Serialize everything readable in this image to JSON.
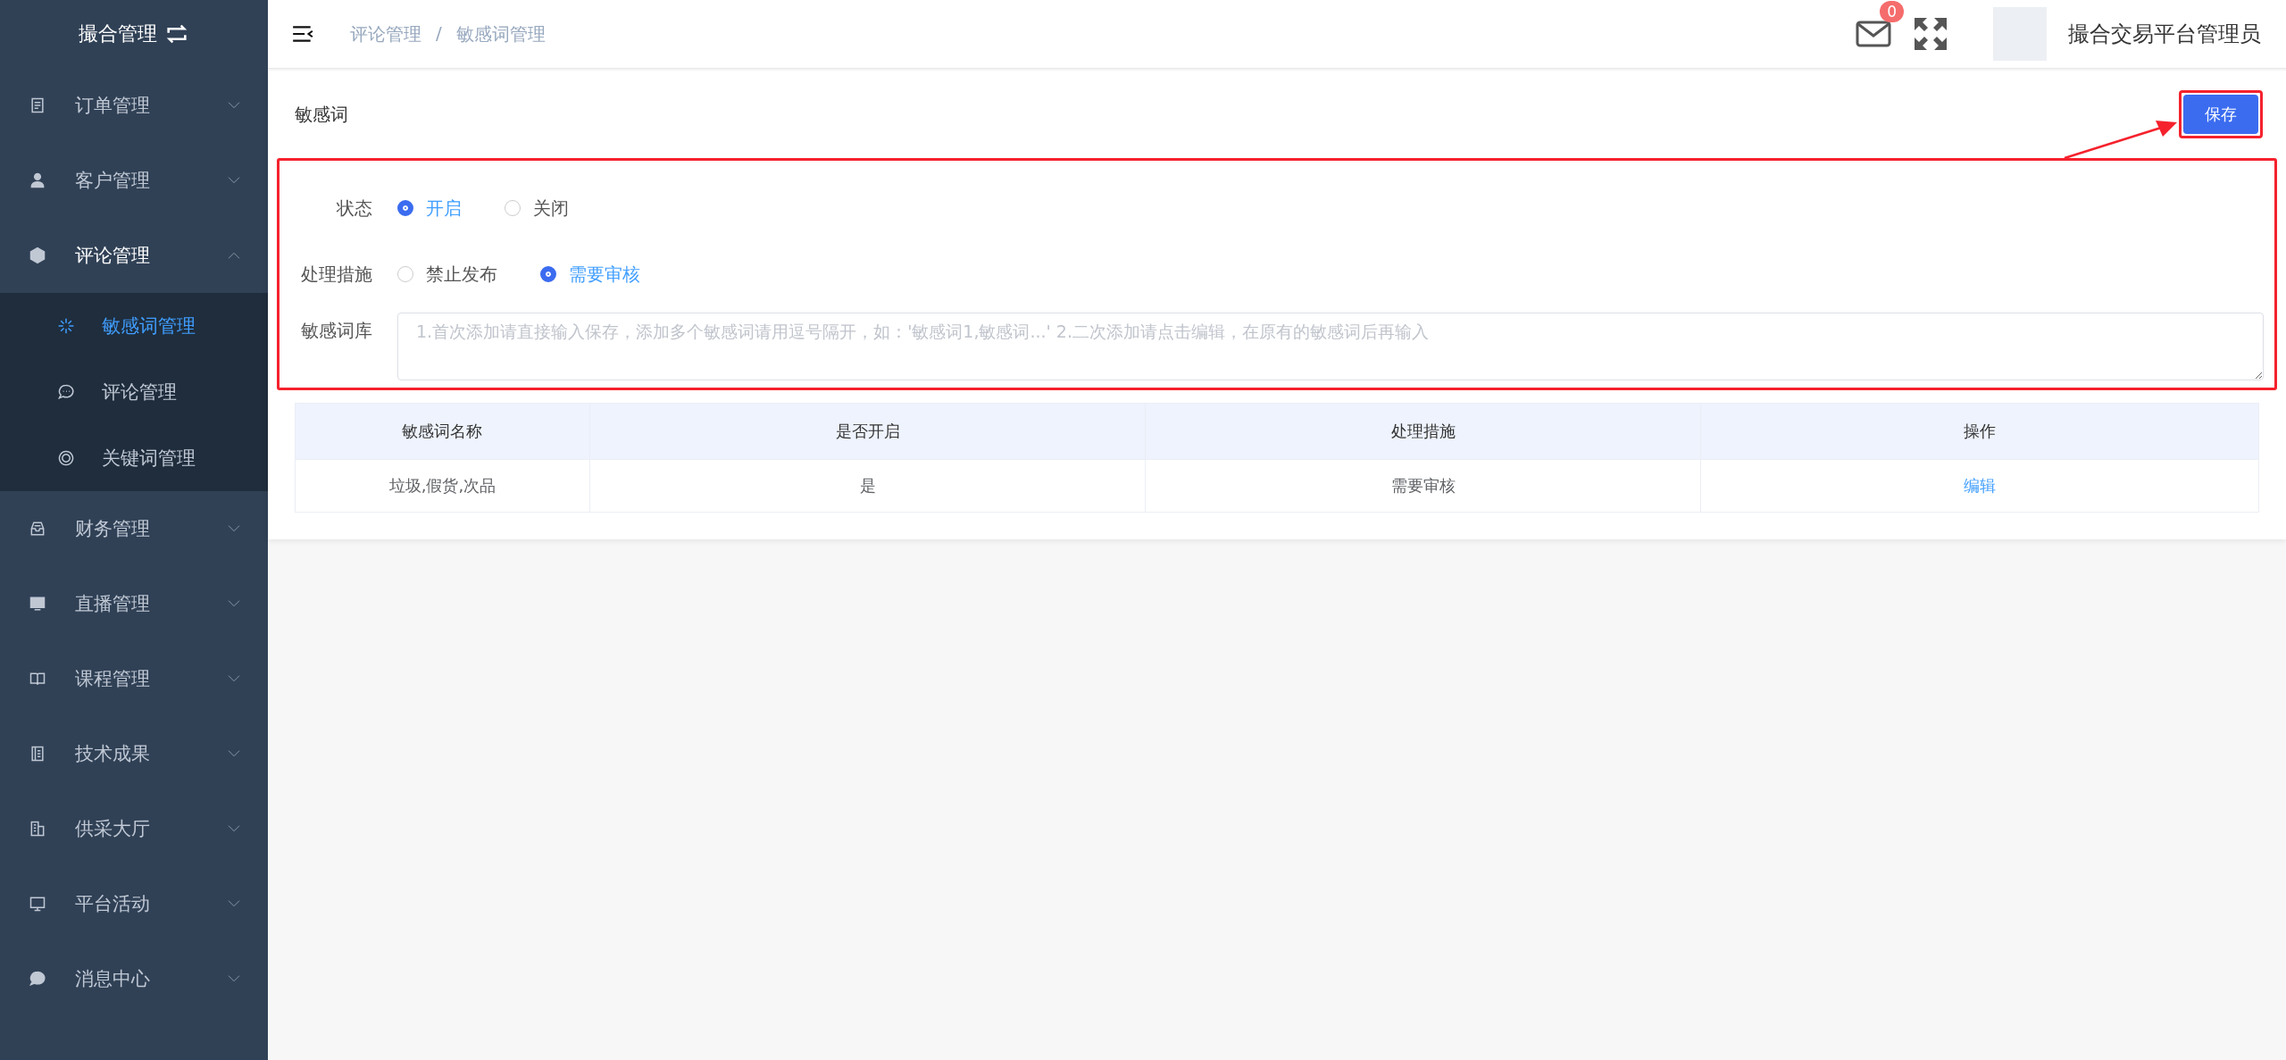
{
  "sidebar": {
    "title": "撮合管理",
    "items": [
      {
        "label": "订单管理",
        "expanded": false
      },
      {
        "label": "客户管理",
        "expanded": false
      },
      {
        "label": "评论管理",
        "expanded": true,
        "children": [
          {
            "label": "敏感词管理",
            "selected": true
          },
          {
            "label": "评论管理",
            "selected": false
          },
          {
            "label": "关键词管理",
            "selected": false
          }
        ]
      },
      {
        "label": "财务管理",
        "expanded": false
      },
      {
        "label": "直播管理",
        "expanded": false
      },
      {
        "label": "课程管理",
        "expanded": false
      },
      {
        "label": "技术成果",
        "expanded": false
      },
      {
        "label": "供采大厅",
        "expanded": false
      },
      {
        "label": "平台活动",
        "expanded": false
      },
      {
        "label": "消息中心",
        "expanded": false
      }
    ]
  },
  "header": {
    "breadcrumb": [
      "评论管理",
      "敏感词管理"
    ],
    "breadcrumb_separator": "/",
    "mail_badge": "0",
    "user_name": "撮合交易平台管理员"
  },
  "page": {
    "title": "敏感词",
    "save_button": "保存",
    "form": {
      "status": {
        "label": "状态",
        "options": [
          {
            "label": "开启",
            "selected": true
          },
          {
            "label": "关闭",
            "selected": false
          }
        ]
      },
      "measure": {
        "label": "处理措施",
        "options": [
          {
            "label": "禁止发布",
            "selected": false
          },
          {
            "label": "需要审核",
            "selected": true
          }
        ]
      },
      "library": {
        "label": "敏感词库",
        "placeholder": "1.首次添加请直接输入保存，添加多个敏感词请用逗号隔开，如：'敏感词1,敏感词...' 2.二次添加请点击编辑，在原有的敏感词后再输入"
      }
    },
    "table": {
      "columns": [
        "敏感词名称",
        "是否开启",
        "处理措施",
        "操作"
      ],
      "rows": [
        {
          "name": "垃圾,假货,次品",
          "enabled": "是",
          "measure": "需要审核",
          "action": "编辑"
        }
      ]
    }
  }
}
